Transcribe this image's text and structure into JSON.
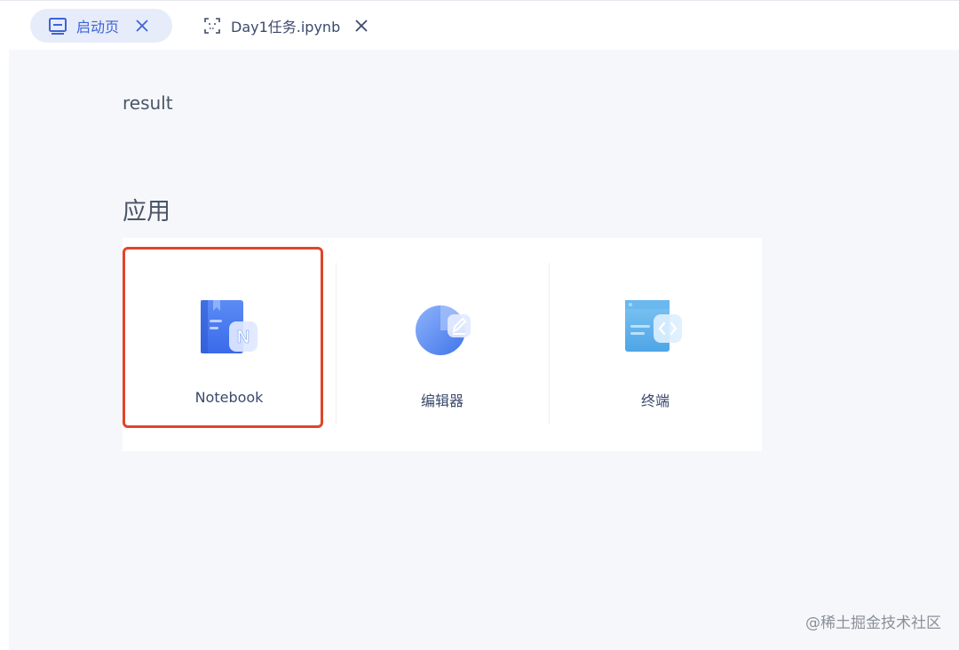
{
  "tabs": [
    {
      "label": "启动页",
      "icon": "launcher-icon",
      "active": true
    },
    {
      "label": "Day1任务.ipynb",
      "icon": "notebook-file-icon",
      "active": false
    }
  ],
  "main": {
    "result_label": "result",
    "section_title": "应用",
    "apps": [
      {
        "label": "Notebook",
        "icon": "notebook-icon",
        "highlighted": true
      },
      {
        "label": "编辑器",
        "icon": "editor-icon"
      },
      {
        "label": "终端",
        "icon": "terminal-icon"
      }
    ]
  },
  "watermark": "@稀土掘金技术社区",
  "colors": {
    "accent": "#3d63d9",
    "active_tab_bg": "#e7ecfa",
    "highlight_border": "#e0452b",
    "main_bg": "#f6f7fa"
  }
}
